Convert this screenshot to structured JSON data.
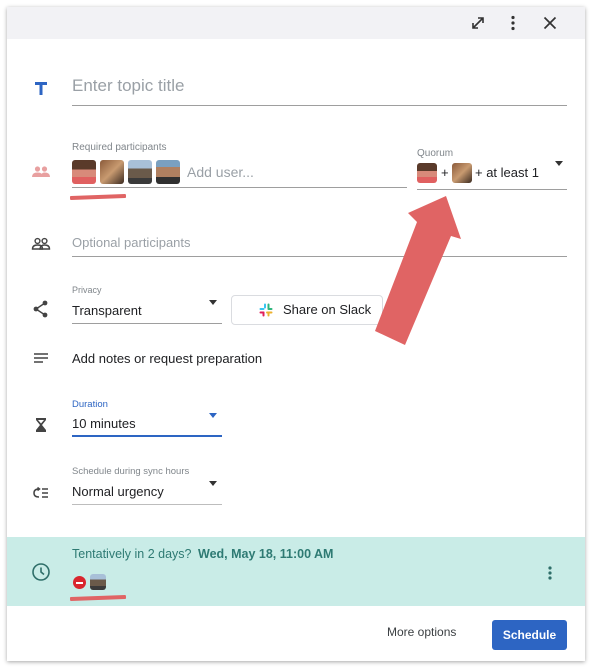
{
  "header": {
    "buttons": [
      {
        "name": "expand",
        "icon": "expand-icon"
      },
      {
        "name": "more",
        "icon": "more-vert-icon"
      },
      {
        "name": "close",
        "icon": "close-icon"
      }
    ]
  },
  "topic": {
    "icon": "title-T-icon",
    "placeholder": "Enter topic title",
    "accent": "#2d65c3"
  },
  "required_participants": {
    "icon": "people-icon",
    "label": "Required participants",
    "avatars": [
      "person-1",
      "person-2",
      "person-3",
      "person-4"
    ],
    "placeholder": "Add user..."
  },
  "quorum": {
    "label": "Quorum",
    "avatars": [
      "person-1",
      "person-2"
    ],
    "plus": "+",
    "suffix": "+ at least 1"
  },
  "optional_participants": {
    "icon": "people-outline-icon",
    "placeholder": "Optional participants"
  },
  "privacy": {
    "icon": "share-icon",
    "label": "Privacy",
    "value": "Transparent"
  },
  "slack": {
    "icon": "slack-icon",
    "label": "Share on Slack"
  },
  "notes": {
    "icon": "notes-icon",
    "label": "Add notes or request preparation"
  },
  "duration": {
    "icon": "hourglass-icon",
    "label": "Duration",
    "value": "10 minutes",
    "accent": "#2d65c3"
  },
  "urgency": {
    "icon": "sync-hours-icon",
    "label": "Schedule during sync hours",
    "value": "Normal urgency"
  },
  "suggestion": {
    "icon": "clock-icon",
    "prefix": "Tentatively in 2 days?",
    "datetime": "Wed, May 18, 11:00 AM",
    "conflict_icon": "blocked-icon",
    "conflict_avatar": "person-3",
    "background": "#c9ece7"
  },
  "footer": {
    "more_options": "More options",
    "schedule": "Schedule",
    "primary": "#2d65c3"
  },
  "annotations": {
    "color": "#e06464"
  }
}
